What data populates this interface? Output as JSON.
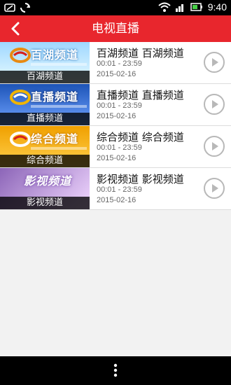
{
  "status": {
    "time": "9:40"
  },
  "header": {
    "title": "电视直播"
  },
  "channels": [
    {
      "thumb_label": "百湖频道",
      "banner": "百湖频道",
      "title": "百湖频道 百湖频道",
      "time_range": "00:01 - 23:59",
      "date": "2015-02-16",
      "theme": "sky"
    },
    {
      "thumb_label": "直播频道",
      "banner": "直播频道",
      "title": "直播频道 直播频道",
      "time_range": "00:01 - 23:59",
      "date": "2015-02-16",
      "theme": "blue"
    },
    {
      "thumb_label": "综合频道",
      "banner": "综合频道",
      "title": "综合频道 综合频道",
      "time_range": "00:01 - 23:59",
      "date": "2015-02-16",
      "theme": "gold"
    },
    {
      "thumb_label": "影视频道",
      "banner": "影视频道",
      "title": "影视频道 影视频道",
      "time_range": "00:01 - 23:59",
      "date": "2015-02-16",
      "theme": "purple"
    }
  ],
  "colors": {
    "accent": "#e8262d",
    "background": "#f2f2f2",
    "text": "#111111",
    "meta": "#666666"
  }
}
